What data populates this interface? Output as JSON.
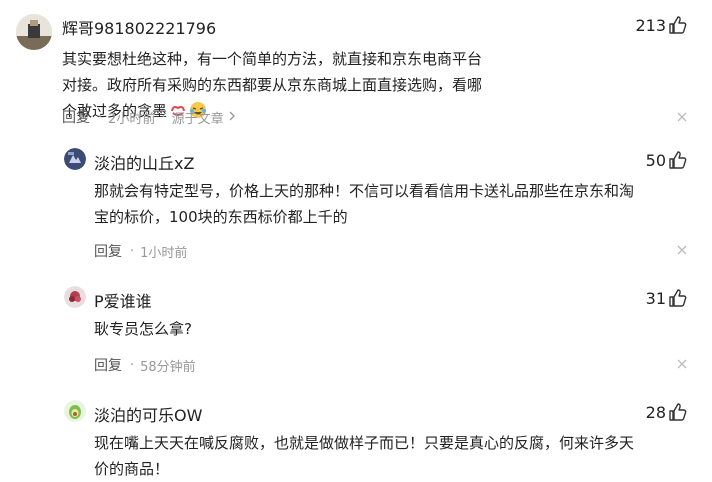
{
  "comments": [
    {
      "name": "辉哥981802221796",
      "likes": "213",
      "text": "其实要想杜绝这种，有一个简单的方法，就直接和京东电商平台对接。政府所有采购的东西都要从京东商城上面直接选购，看哪个敢过多的贪墨",
      "reply": "回复",
      "time": "2小时前",
      "source": "源于文章",
      "emojis": [
        "kiss-emoji",
        "laugh-cry-emoji"
      ]
    },
    {
      "name": "淡泊的山丘xZ",
      "likes": "50",
      "text": "那就会有特定型号，价格上天的那种！不信可以看看信用卡送礼品那些在京东和淘宝的标价，100块的东西标价都上千的",
      "reply": "回复",
      "time": "1小时前"
    },
    {
      "name": "P爱谁谁",
      "likes": "31",
      "text": "耿专员怎么拿?",
      "reply": "回复",
      "time": "58分钟前"
    },
    {
      "name": "淡泊的可乐OW",
      "likes": "28",
      "text": "现在嘴上天天在喊反腐败，也就是做做样子而已！只要是真心的反腐，何来许多天价的商品！"
    }
  ],
  "colors": {
    "text": "#222222",
    "meta": "#999999",
    "reply": "#555555"
  }
}
